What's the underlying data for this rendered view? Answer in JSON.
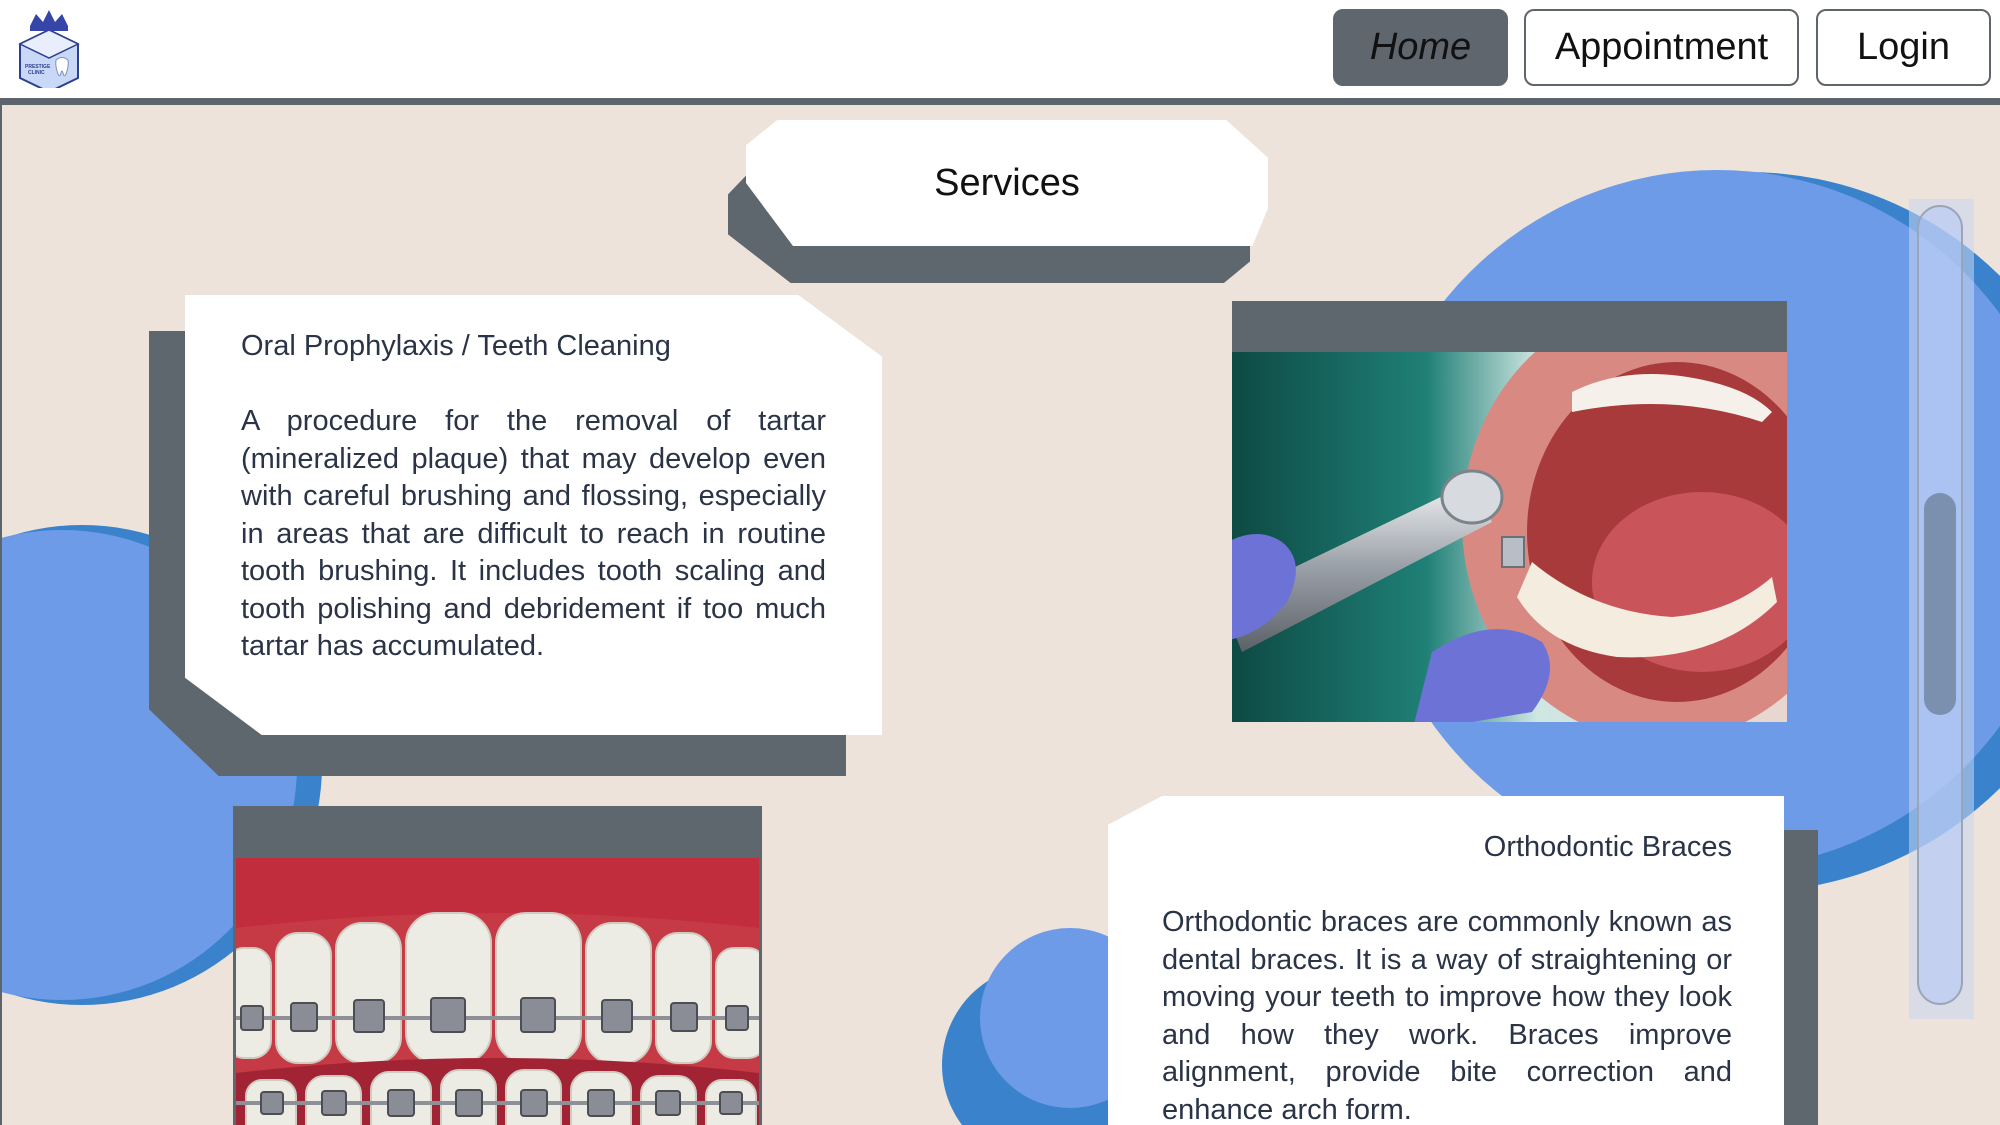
{
  "header": {
    "logo": {
      "icon": "crown-tooth-logo",
      "text": "PRESTIGE CLINIC"
    },
    "nav": [
      {
        "label": "Home",
        "active": true
      },
      {
        "label": "Appointment",
        "active": false
      },
      {
        "label": "Login",
        "active": false
      }
    ]
  },
  "main": {
    "title": "Services",
    "services": [
      {
        "title": "Oral Prophylaxis / Teeth Cleaning",
        "body": "A procedure for the removal of tartar (mineralized plaque) that may develop even with careful brushing and flossing, especially in areas that are difficult to reach in routine tooth brushing. It includes tooth scaling and tooth polishing and debridement if too much tartar has accumulated."
      },
      {
        "title": "Orthodontic Braces",
        "body": "Orthodontic braces are commonly known as dental braces. It is a way of straightening or moving your teeth to improve how they look and how they work. Braces improve alignment, provide bite correction and enhance arch form."
      }
    ]
  },
  "colors": {
    "background": "#ede3da",
    "frame": "#5e666e",
    "accent_blue": "#6d9be8",
    "accent_blue_dark": "#3b82cc"
  },
  "scrollbar": {
    "position": 0.38
  }
}
